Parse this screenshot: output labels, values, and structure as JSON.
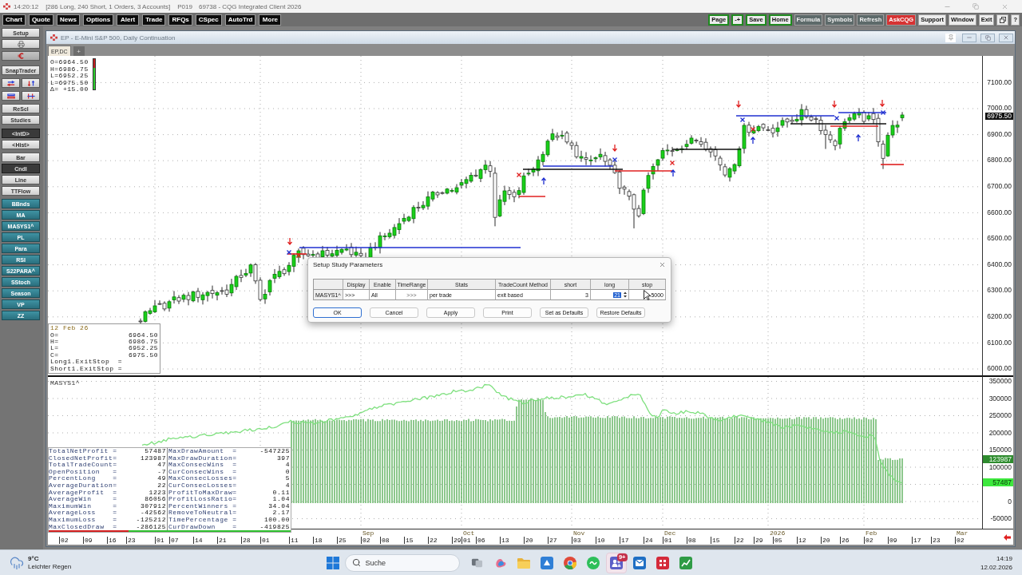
{
  "title_bar": {
    "time": "14:20:12",
    "status": "[286 Long, 240 Short, 1 Orders, 3 Accounts]",
    "page": "P019",
    "app": "69738 - CQG Integrated Client 2026"
  },
  "menu": {
    "left": [
      "Chart",
      "Quote",
      "News",
      "Options",
      "Alert",
      "Trade",
      "RFQs",
      "CSpec",
      "AutoTrd",
      "More"
    ],
    "right": [
      {
        "label": "Page",
        "kind": "framed"
      },
      {
        "label": "-+",
        "kind": "framed"
      },
      {
        "label": "Save",
        "kind": "framed"
      },
      {
        "label": "Home",
        "kind": "framed"
      },
      {
        "label": "Formula",
        "kind": "dark"
      },
      {
        "label": "Symbols",
        "kind": "dark"
      },
      {
        "label": "Refresh",
        "kind": "dark"
      },
      {
        "label": "AskCQG",
        "kind": "alert"
      },
      {
        "label": "Support",
        "kind": "plain"
      },
      {
        "label": "Window",
        "kind": "plain"
      },
      {
        "label": "Exit",
        "kind": "plain"
      },
      {
        "kind": "icon"
      },
      {
        "label": "?",
        "kind": "plain"
      }
    ]
  },
  "toolbar": {
    "setup": "Setup",
    "snap_trader": "SnapTrader",
    "actions": [
      "ReScl",
      "Studies"
    ],
    "modes": [
      {
        "label": "<IntD>",
        "selected": true
      },
      {
        "label": "<Hist>",
        "selected": false
      }
    ],
    "chart_types": [
      {
        "label": "Bar",
        "selected": false
      },
      {
        "label": "Cndl",
        "selected": true
      },
      {
        "label": "Line",
        "selected": false
      },
      {
        "label": "TTFlow",
        "selected": false
      }
    ],
    "studies": [
      "BBnds",
      "MA",
      "MASYS1^",
      "PL",
      "Para",
      "RSI",
      "S22PARA^",
      "SStoch",
      "Season",
      "VP",
      "ZZ"
    ]
  },
  "chart_window": {
    "title": "EP - E-Mini S&P 500, Daily Continuation",
    "tabs": [
      {
        "label": "EP,DC",
        "selected": true
      }
    ],
    "new_tab": "+"
  },
  "price_chart": {
    "legend": [
      "O=6964.50",
      "H=6986.75",
      "L=6952.25",
      "L=6975.50",
      "Δ= +15.00"
    ],
    "price_axis": [
      "7100.00",
      "7000.00",
      "6900.00",
      "6800.00",
      "6700.00",
      "6600.00",
      "6500.00",
      "6400.00",
      "6300.00",
      "6200.00",
      "6100.00",
      "6000.00"
    ],
    "last_price": "6975.50",
    "data_box": {
      "date": "12 Feb 26",
      "rows": [
        {
          "label": "O=",
          "value": "6964.50"
        },
        {
          "label": "H=",
          "value": "6986.75"
        },
        {
          "label": "L=",
          "value": "6952.25"
        },
        {
          "label": "C=",
          "value": "6975.50"
        }
      ],
      "stops": [
        "Long1.ExitStop  =",
        "Short1.ExitStop ="
      ]
    }
  },
  "study_pane": {
    "title": "MASYS1^",
    "axis": [
      "350000",
      "300000",
      "250000",
      "200000",
      "150000",
      "100000",
      "0",
      "-50000"
    ],
    "value_tags": [
      {
        "label": "123987",
        "color": "#2e8b2e"
      },
      {
        "label": "57487",
        "color": "#3ee83e"
      }
    ],
    "stats_left": [
      {
        "name": "TotalNetProfit =",
        "value": "57487"
      },
      {
        "name": "ClosedNetProfit=",
        "value": "123987"
      },
      {
        "name": "TotalTradeCount=",
        "value": "47"
      },
      {
        "name": "OpenPosition   =",
        "value": "-7"
      },
      {
        "name": "PercentLong    =",
        "value": "49"
      },
      {
        "name": "AverageDuration=",
        "value": "22"
      },
      {
        "name": "AverageProfit  =",
        "value": "1223"
      },
      {
        "name": "AverageWin     =",
        "value": "86056"
      },
      {
        "name": "MaximumWin     =",
        "value": "307912"
      },
      {
        "name": "AverageLoss    =",
        "value": "-42562"
      },
      {
        "name": "MaximumLoss    =",
        "value": "-125212"
      },
      {
        "name": "MaxClosedDraw  =",
        "value": "-286125"
      }
    ],
    "stats_right": [
      {
        "name": "MaxDrawAmount  =",
        "value": "-547225"
      },
      {
        "name": "MaxDrawDuration=",
        "value": "397"
      },
      {
        "name": "MaxConsecWins  =",
        "value": "4"
      },
      {
        "name": "CurConsecWins  =",
        "value": "0"
      },
      {
        "name": "MaxConsecLosses=",
        "value": "5"
      },
      {
        "name": "CurConsecLosses=",
        "value": "4"
      },
      {
        "name": "ProfitToMaxDraw=",
        "value": "0.11"
      },
      {
        "name": "ProfitLossRatio=",
        "value": "1.04"
      },
      {
        "name": "PercentWinners =",
        "value": "34.04"
      },
      {
        "name": "RemoveToNeutral=",
        "value": "2.17"
      },
      {
        "name": "TimePercentage =",
        "value": "100.00"
      },
      {
        "name": "CurDrawDown    =",
        "value": "-419825"
      }
    ]
  },
  "time_axis": {
    "months": [
      "Sep",
      "Oct",
      "Nov",
      "Dec",
      "2026",
      "Feb",
      "Mar"
    ],
    "days": [
      "02",
      "09",
      "16",
      "23",
      "01",
      "07",
      "14",
      "21",
      "28",
      "01",
      "11",
      "18",
      "25",
      "02",
      "08",
      "15",
      "22",
      "29",
      "01",
      "06",
      "13",
      "20",
      "27",
      "03",
      "10",
      "17",
      "24",
      "01",
      "08",
      "15",
      "22",
      "29",
      "05",
      "12",
      "20",
      "26",
      "02",
      "09",
      "17",
      "23",
      "02"
    ]
  },
  "dialog": {
    "title": "Setup Study Parameters",
    "columns": [
      "Display",
      "Enable",
      "TimeRange",
      "Stats",
      "TradeCount Method",
      "short",
      "long",
      "stop"
    ],
    "row": {
      "name": "MASYS1^",
      "cells": [
        {
          "value": ">>>",
          "kind": "text",
          "editing": false
        },
        {
          "value": "All",
          "kind": "text",
          "editing": false
        },
        {
          "value": ">>>",
          "kind": "picker",
          "editing": false
        },
        {
          "value": "per trade",
          "kind": "text",
          "editing": false
        },
        {
          "value": "exit based",
          "kind": "text",
          "editing": false
        },
        {
          "value": "3",
          "kind": "number",
          "editing": false
        },
        {
          "value": "21",
          "kind": "number",
          "editing": true
        },
        {
          "value": "5000",
          "kind": "number",
          "editing": false
        }
      ]
    },
    "buttons": [
      {
        "label": "OK",
        "focused": true
      },
      {
        "label": "Cancel",
        "focused": false
      },
      {
        "label": "Apply",
        "focused": false
      },
      {
        "label": "Print",
        "focused": false
      },
      {
        "label": "Set as Defaults",
        "focused": false
      },
      {
        "label": "Restore Defaults",
        "focused": false
      }
    ]
  },
  "taskbar": {
    "weather": {
      "temperature": "9°C",
      "condition": "Leichter Regen"
    },
    "search": {
      "placeholder": "Suche"
    },
    "apps": [
      {
        "active": false
      },
      {
        "active": false
      },
      {
        "active": false
      },
      {
        "active": false
      },
      {
        "active": false
      },
      {
        "active": false
      },
      {
        "active": true,
        "badge": "9+"
      },
      {
        "active": false
      },
      {
        "active": false
      },
      {
        "active": false
      }
    ],
    "time": "14:19",
    "date": "12.02.2026"
  }
}
